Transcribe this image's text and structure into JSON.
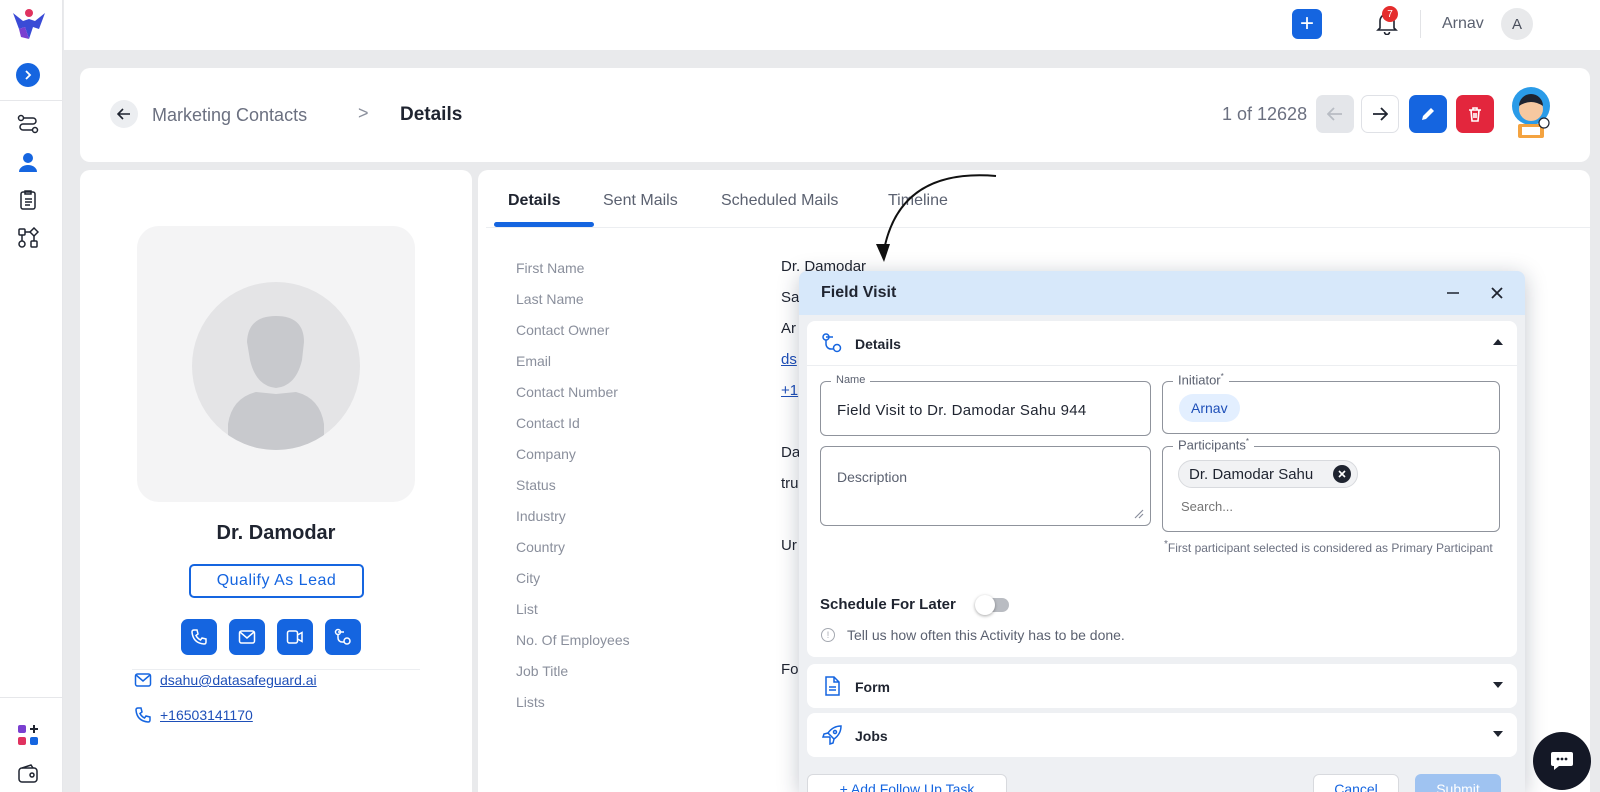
{
  "header": {
    "username": "Arnav",
    "avatar_initial": "A",
    "notification_count": "7",
    "plus_label": "+"
  },
  "breadcrumb": {
    "parent": "Marketing Contacts",
    "separator": ">",
    "current": "Details",
    "counter": "1 of 12628"
  },
  "profile": {
    "name": "Dr. Damodar",
    "qualify_label": "Qualify As Lead",
    "email": "dsahu@datasafeguard.ai",
    "phone": "+16503141170"
  },
  "tabs": [
    {
      "label": "Details",
      "active": true
    },
    {
      "label": "Sent Mails"
    },
    {
      "label": "Scheduled Mails"
    },
    {
      "label": "Timeline"
    }
  ],
  "fields": {
    "labels": [
      "First Name",
      "Last Name",
      "Contact Owner",
      "Email",
      "Contact Number",
      "Contact Id",
      "Company",
      "Status",
      "Industry",
      "Country",
      "City",
      "List",
      "No. Of Employees",
      "Job Title",
      "Lists"
    ],
    "values": {
      "first_name": "Dr. Damodar",
      "last_name": "Sa",
      "contact_owner": "Ar",
      "email": "ds",
      "contact_number": "+1",
      "company": "Da",
      "status": "tru",
      "country": "Ur",
      "job_title": "Fo"
    }
  },
  "modal": {
    "title": "Field Visit",
    "details_section": "Details",
    "name_label": "Name",
    "name_value": "Field Visit to Dr. Damodar Sahu 944",
    "initiator_label": "Initiator",
    "initiator_value": "Arnav",
    "description_placeholder": "Description",
    "participants_label": "Participants",
    "participant": "Dr. Damodar Sahu",
    "search_placeholder": "Search...",
    "required_mark": "*",
    "participant_note": "First participant selected is considered as Primary Participant",
    "schedule_label": "Schedule For Later",
    "schedule_hint": "Tell us how often this Activity has to be done.",
    "form_section": "Form",
    "jobs_section": "Jobs",
    "add_followup": "+ Add Follow Up Task",
    "cancel": "Cancel",
    "submit": "Submit"
  },
  "colors": {
    "primary": "#1565e0",
    "danger": "#e3263d",
    "modal_header": "#d7e8fa"
  }
}
